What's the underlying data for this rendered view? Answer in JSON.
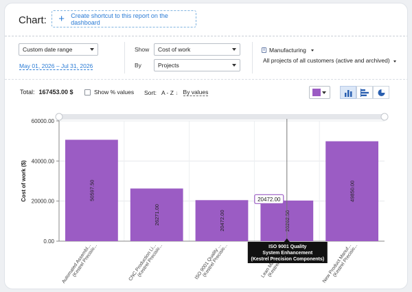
{
  "header": {
    "chart_label": "Chart:",
    "shortcut_label": "Create shortcut to this report on the dashboard"
  },
  "filters": {
    "date_select": "Custom date range",
    "date_range": "May 01, 2026 – Jul 31, 2026",
    "show_label": "Show",
    "show_value": "Cost of work",
    "by_label": "By",
    "by_value": "Projects",
    "department": "Manufacturing",
    "scope": "All projects of all customers (active and archived)"
  },
  "toolbar": {
    "total_label": "Total:",
    "total_value": "167453.00 $",
    "percent_label": "Show % values",
    "sort_label": "Sort:",
    "sort_value": "A - Z",
    "sort_by": "By values"
  },
  "colors": {
    "bar": "#9b5cc4",
    "accent": "#2a7bd5"
  },
  "tooltip": {
    "value": "20472.00",
    "lines": [
      "ISO 9001 Quality",
      "System Enhancement",
      "(Kestrel Precision Components)"
    ]
  },
  "chart_data": {
    "type": "bar",
    "ylabel": "Cost of work ($)",
    "xlabel": "",
    "ylim": [
      0,
      60000
    ],
    "yticks": [
      "0.00",
      "20000.00",
      "40000.00",
      "60000.00"
    ],
    "categories": [
      [
        "Automated Assembl...",
        "(Kestrel Precisio..."
      ],
      [
        "CNC Production Li...",
        "(Kestrel Precisio..."
      ],
      [
        "ISO 9001 Quality ...",
        "(Kestrel Precisio..."
      ],
      [
        "Lean Manufactur...",
        "(Kestrel Precisio..."
      ],
      [
        "New Product Manuf...",
        "(Kestrel Precisio..."
      ]
    ],
    "values": [
      50597.5,
      26271.0,
      20472.0,
      20262.5,
      49850.0
    ],
    "labels": [
      "50597.50",
      "26271.00",
      "20472.00",
      "20262.50",
      "49850.00"
    ],
    "grid": true
  }
}
